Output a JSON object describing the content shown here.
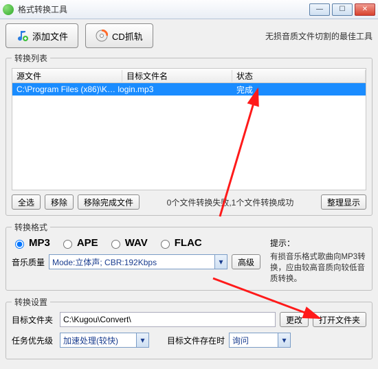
{
  "window": {
    "title": "格式转换工具",
    "tagline": "无损音质文件切割的最佳工具"
  },
  "toolbar": {
    "add_label": "添加文件",
    "cd_label": "CD抓轨"
  },
  "list": {
    "legend": "转换列表",
    "col_source": "源文件",
    "col_target": "目标文件名",
    "col_status": "状态",
    "rows": [
      {
        "source": "C:\\Program Files (x86)\\K… login.mp3",
        "target": "",
        "status": "完成"
      }
    ],
    "select_all": "全选",
    "remove": "移除",
    "remove_done": "移除完成文件",
    "status_summary": "0个文件转换失败,1个文件转换成功",
    "tidy": "整理显示"
  },
  "format": {
    "legend": "转换格式",
    "options": {
      "mp3": "MP3",
      "ape": "APE",
      "wav": "WAV",
      "flac": "FLAC"
    },
    "selected": "mp3",
    "quality_label": "音乐质量",
    "quality_value": "Mode:立体声; CBR:192Kbps",
    "advanced": "高级",
    "hint_title": "提示：",
    "hint_body": "有损音乐格式歌曲向MP3转换，应由较高音质向较低音质转换。"
  },
  "settings": {
    "legend": "转换设置",
    "target_folder_label": "目标文件夹",
    "target_folder_value": "C:\\Kugou\\Convert\\",
    "change": "更改",
    "open_folder": "打开文件夹",
    "priority_label": "任务优先级",
    "priority_value": "加速处理(较快)",
    "exists_label": "目标文件存在时",
    "exists_value": "询问"
  }
}
